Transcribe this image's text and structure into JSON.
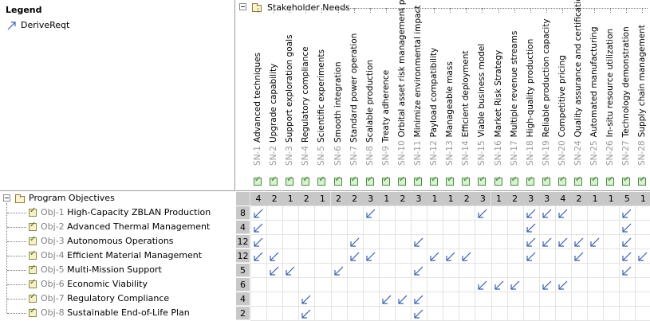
{
  "legend": {
    "title": "Legend",
    "item_label": "DeriveReqt"
  },
  "header": {
    "root_label": "Stakeholder Needs"
  },
  "tree": {
    "root_label": "Program Objectives"
  },
  "columns": [
    {
      "id": "SN-1",
      "label": "Advanced techniques",
      "count": "4"
    },
    {
      "id": "SN-2",
      "label": "Upgrade capability",
      "count": "2"
    },
    {
      "id": "SN-3",
      "label": "Support exploration goals",
      "count": "1"
    },
    {
      "id": "SN-4",
      "label": "Regulatory compliance",
      "count": "2"
    },
    {
      "id": "SN-5",
      "label": "Scientific experiments",
      "count": "1"
    },
    {
      "id": "SN-6",
      "label": "Smooth integration",
      "count": "2"
    },
    {
      "id": "SN-7",
      "label": "Standard power operation",
      "count": "2"
    },
    {
      "id": "SN-8",
      "label": "Scalable production",
      "count": "3"
    },
    {
      "id": "SN-9",
      "label": "Treaty adherence",
      "count": "1"
    },
    {
      "id": "SN-10",
      "label": "Orbital asset risk management plan",
      "count": "2"
    },
    {
      "id": "SN-11",
      "label": "Minimize environmental impact",
      "count": "3"
    },
    {
      "id": "SN-12",
      "label": "Payload compatibility",
      "count": "1"
    },
    {
      "id": "SN-13",
      "label": "Manageable mass",
      "count": "1"
    },
    {
      "id": "SN-14",
      "label": "Efficient deployment",
      "count": "2"
    },
    {
      "id": "SN-15",
      "label": "Viable business model",
      "count": "3"
    },
    {
      "id": "SN-16",
      "label": "Market Risk Strategy",
      "count": "1"
    },
    {
      "id": "SN-17",
      "label": "Multiple revenue streams",
      "count": "2"
    },
    {
      "id": "SN-18",
      "label": "High-quality production",
      "count": "3"
    },
    {
      "id": "SN-19",
      "label": "Reliable production capacity",
      "count": "3"
    },
    {
      "id": "SN-20",
      "label": "Competitive pricing",
      "count": "4"
    },
    {
      "id": "SN-24",
      "label": "Quality assurance and certification",
      "count": "2"
    },
    {
      "id": "SN-25",
      "label": "Automated manufacturing",
      "count": "1"
    },
    {
      "id": "SN-26",
      "label": "In-situ resource utilization",
      "count": "1"
    },
    {
      "id": "SN-27",
      "label": "Technology demonstration",
      "count": "5"
    },
    {
      "id": "SN-28",
      "label": "Supply chain management",
      "count": "1"
    }
  ],
  "rows": [
    {
      "id": "Obj-1",
      "label": "High-Capacity ZBLAN Production",
      "count": "8",
      "cells": [
        0,
        7,
        14,
        17,
        18,
        19,
        23
      ]
    },
    {
      "id": "Obj-2",
      "label": "Advanced Thermal Management",
      "count": "4",
      "cells": [
        0,
        17,
        23
      ]
    },
    {
      "id": "Obj-3",
      "label": "Autonomous Operations",
      "count": "12",
      "cells": [
        0,
        6,
        10,
        17,
        18,
        19,
        20,
        21,
        23
      ]
    },
    {
      "id": "Obj-4",
      "label": "Efficient Material Management",
      "count": "12",
      "cells": [
        0,
        1,
        6,
        7,
        11,
        12,
        13,
        17,
        20,
        23,
        24
      ]
    },
    {
      "id": "Obj-5",
      "label": "Multi-Mission Support",
      "count": "5",
      "cells": [
        1,
        2,
        5,
        10,
        23
      ]
    },
    {
      "id": "Obj-6",
      "label": "Economic Viability",
      "count": "6",
      "cells": [
        14,
        15,
        16,
        18,
        19
      ]
    },
    {
      "id": "Obj-7",
      "label": "Regulatory Compliance",
      "count": "4",
      "cells": [
        3,
        8,
        9,
        10
      ]
    },
    {
      "id": "Obj-8",
      "label": "Sustainable End-of-Life Plan",
      "count": "2",
      "cells": [
        3,
        10
      ]
    }
  ],
  "colors": {
    "count_bg": "#c8c8c8",
    "arrow": "#3a5fb0",
    "grid": "#e3e3e3"
  },
  "icons": {
    "legend_item": "derive-arrow-icon",
    "tree_toggle": "collapse-icon",
    "folder": "folder-icon",
    "requirement": "requirement-icon"
  }
}
